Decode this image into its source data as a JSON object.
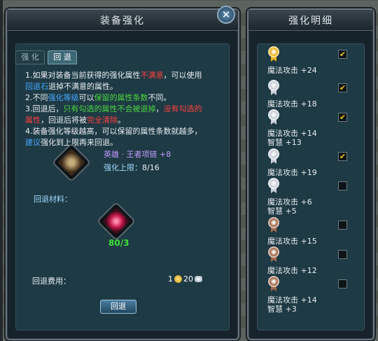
{
  "left_panel": {
    "title": "装备强化",
    "close_icon": "close-icon",
    "tabs": [
      "强 化",
      "回 退"
    ],
    "active_tab": 1,
    "description": {
      "l1a": "1.如果对装备当前获得的强化属性",
      "l1b": "不满意",
      "l1c": "，可以使用",
      "l2a": "回退石",
      "l2b": "退掉不满意的属性。",
      "l3a": "2.不同",
      "l3b": "强化等级",
      "l3c": "可以",
      "l3d": "保留的属性条数",
      "l3e": "不同。",
      "l4a": "3.回退后，",
      "l4b": "只有勾选的属性不会被退掉",
      "l4c": "，",
      "l4d": "没有勾选的",
      "l5a": "属性",
      "l5b": "，回退后将被",
      "l5c": "完全清除",
      "l5d": "。",
      "l6": "4.装备强化等级越高，可以保留的属性条数就越多，",
      "l7a": "建议",
      "l7b": "强化到上限再来回退。"
    },
    "item": {
      "name": "英雄 · 王者项链 +8",
      "limit_label": "强化上限：",
      "limit_value": "8/16",
      "icon": "necklace-icon"
    },
    "material": {
      "label": "回退材料：",
      "icon": "rollback-stone-icon",
      "count": "80/3"
    },
    "cost": {
      "label": "回退费用：",
      "gold": "1",
      "silver": "20",
      "gold_icon": "gold-coin-icon",
      "silver_icon": "silver-icon"
    },
    "button": "回退"
  },
  "right_panel": {
    "title": "强化明细",
    "rows": [
      {
        "medal": "gold",
        "color": "#e9b21d",
        "lines": [
          "魔法攻击 +24"
        ],
        "checked": true
      },
      {
        "medal": "silver",
        "color": "#c9ced8",
        "lines": [
          "魔法攻击 +18"
        ],
        "checked": true
      },
      {
        "medal": "silver",
        "color": "#c9ced8",
        "lines": [
          "魔法攻击 +14",
          "智慧 +13"
        ],
        "checked": true
      },
      {
        "medal": "silver",
        "color": "#c9ced8",
        "lines": [
          "魔法攻击 +19"
        ],
        "checked": true
      },
      {
        "medal": "silver",
        "color": "#c9ced8",
        "lines": [
          "魔法攻击 +6",
          "智慧 +5"
        ],
        "checked": false
      },
      {
        "medal": "bronze",
        "color": "#a0694b",
        "lines": [
          "魔法攻击 +15"
        ],
        "checked": false
      },
      {
        "medal": "bronze",
        "color": "#a0694b",
        "lines": [
          "魔法攻击 +12"
        ],
        "checked": false
      },
      {
        "medal": "bronze",
        "color": "#a0694b",
        "lines": [
          "魔法攻击 +14",
          "智慧 +3"
        ],
        "checked": false
      }
    ]
  }
}
